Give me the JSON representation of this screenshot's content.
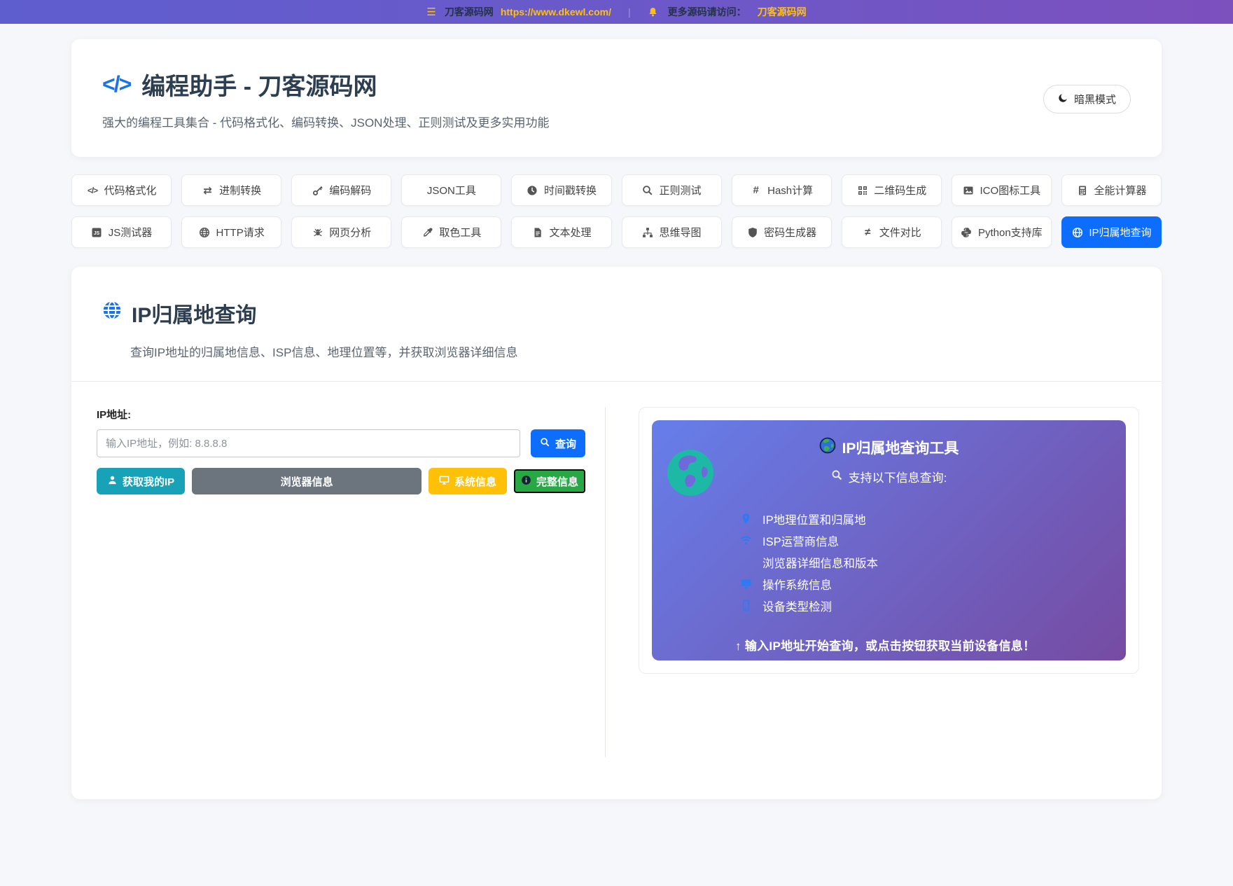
{
  "topbar": {
    "site_name": "刀客源码网",
    "site_url": "https://www.dkewl.com/",
    "separator": "|",
    "more_text": "更多源码请访问：",
    "more_link": "刀客源码网"
  },
  "header": {
    "title": "编程助手 - 刀客源码网",
    "subtitle": "强大的编程工具集合 - 代码格式化、编码转换、JSON处理、正则测试及更多实用功能",
    "code_glyph": "</>",
    "dark_mode_label": "暗黑模式"
  },
  "tools": {
    "items": [
      {
        "label": "代码格式化"
      },
      {
        "label": "进制转换"
      },
      {
        "label": "编码解码"
      },
      {
        "label": "JSON工具"
      },
      {
        "label": "时间戳转换"
      },
      {
        "label": "正则测试"
      },
      {
        "label": "Hash计算"
      },
      {
        "label": "二维码生成"
      },
      {
        "label": "ICO图标工具"
      },
      {
        "label": "全能计算器"
      },
      {
        "label": "JS测试器"
      },
      {
        "label": "HTTP请求"
      },
      {
        "label": "网页分析"
      },
      {
        "label": "取色工具"
      },
      {
        "label": "文本处理"
      },
      {
        "label": "思维导图"
      },
      {
        "label": "密码生成器"
      },
      {
        "label": "文件对比"
      },
      {
        "label": "Python支持库"
      },
      {
        "label": "IP归属地查询"
      }
    ]
  },
  "main": {
    "title": "IP归属地查询",
    "subtitle": "查询IP地址的归属地信息、ISP信息、地理位置等，并获取浏览器详细信息",
    "form": {
      "ip_label": "IP地址:",
      "ip_placeholder": "输入IP地址，例如: 8.8.8.8",
      "ip_value": "",
      "query_button": "查询",
      "my_ip_button": "获取我的IP",
      "browser_button": "浏览器信息",
      "system_button": "系统信息",
      "full_button": "完整信息"
    },
    "panel": {
      "title": "IP归属地查询工具",
      "subtitle": "支持以下信息查询:",
      "features": [
        {
          "text": "IP地理位置和归属地"
        },
        {
          "text": "ISP运营商信息"
        },
        {
          "text": "浏览器详细信息和版本"
        },
        {
          "text": "操作系统信息"
        },
        {
          "text": "设备类型检测"
        }
      ],
      "footer": "↑ 输入IP地址开始查询，或点击按钮获取当前设备信息！"
    }
  },
  "colors": {
    "accent_blue": "#0d6efd",
    "teal": "#17a2b8",
    "gray": "#6c757d",
    "yellow": "#ffc107",
    "green": "#28a745",
    "gradient_start": "#667eea",
    "gradient_end": "#764ba2",
    "topbar_highlight": "#ffc107"
  }
}
